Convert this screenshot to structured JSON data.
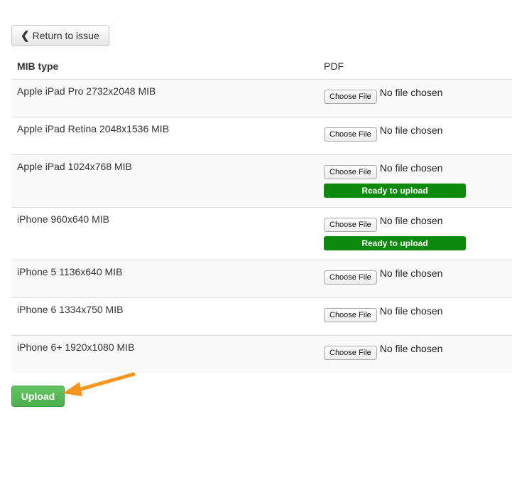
{
  "toolbar": {
    "back_label": "Return to issue",
    "back_icon": "chevron-left-icon"
  },
  "table": {
    "headers": {
      "type": "MIB type",
      "pdf": "PDF"
    },
    "choose_file_label": "Choose File",
    "no_file_label": "No file chosen",
    "rows": [
      {
        "type": "Apple iPad Pro 2732x2048 MIB",
        "status": ""
      },
      {
        "type": "Apple iPad Retina 2048x1536 MIB",
        "status": ""
      },
      {
        "type": "Apple iPad 1024x768 MIB",
        "status": "Ready to upload"
      },
      {
        "type": "iPhone 960x640 MIB",
        "status": "Ready to upload"
      },
      {
        "type": "iPhone 5 1136x640 MIB",
        "status": ""
      },
      {
        "type": "iPhone 6 1334x750 MIB",
        "status": ""
      },
      {
        "type": "iPhone 6+ 1920x1080 MIB",
        "status": ""
      }
    ]
  },
  "actions": {
    "upload_label": "Upload"
  },
  "colors": {
    "ready_bar": "#0b8a0b",
    "upload_button": "#5cb85c",
    "annotation_arrow": "#f7941d"
  }
}
